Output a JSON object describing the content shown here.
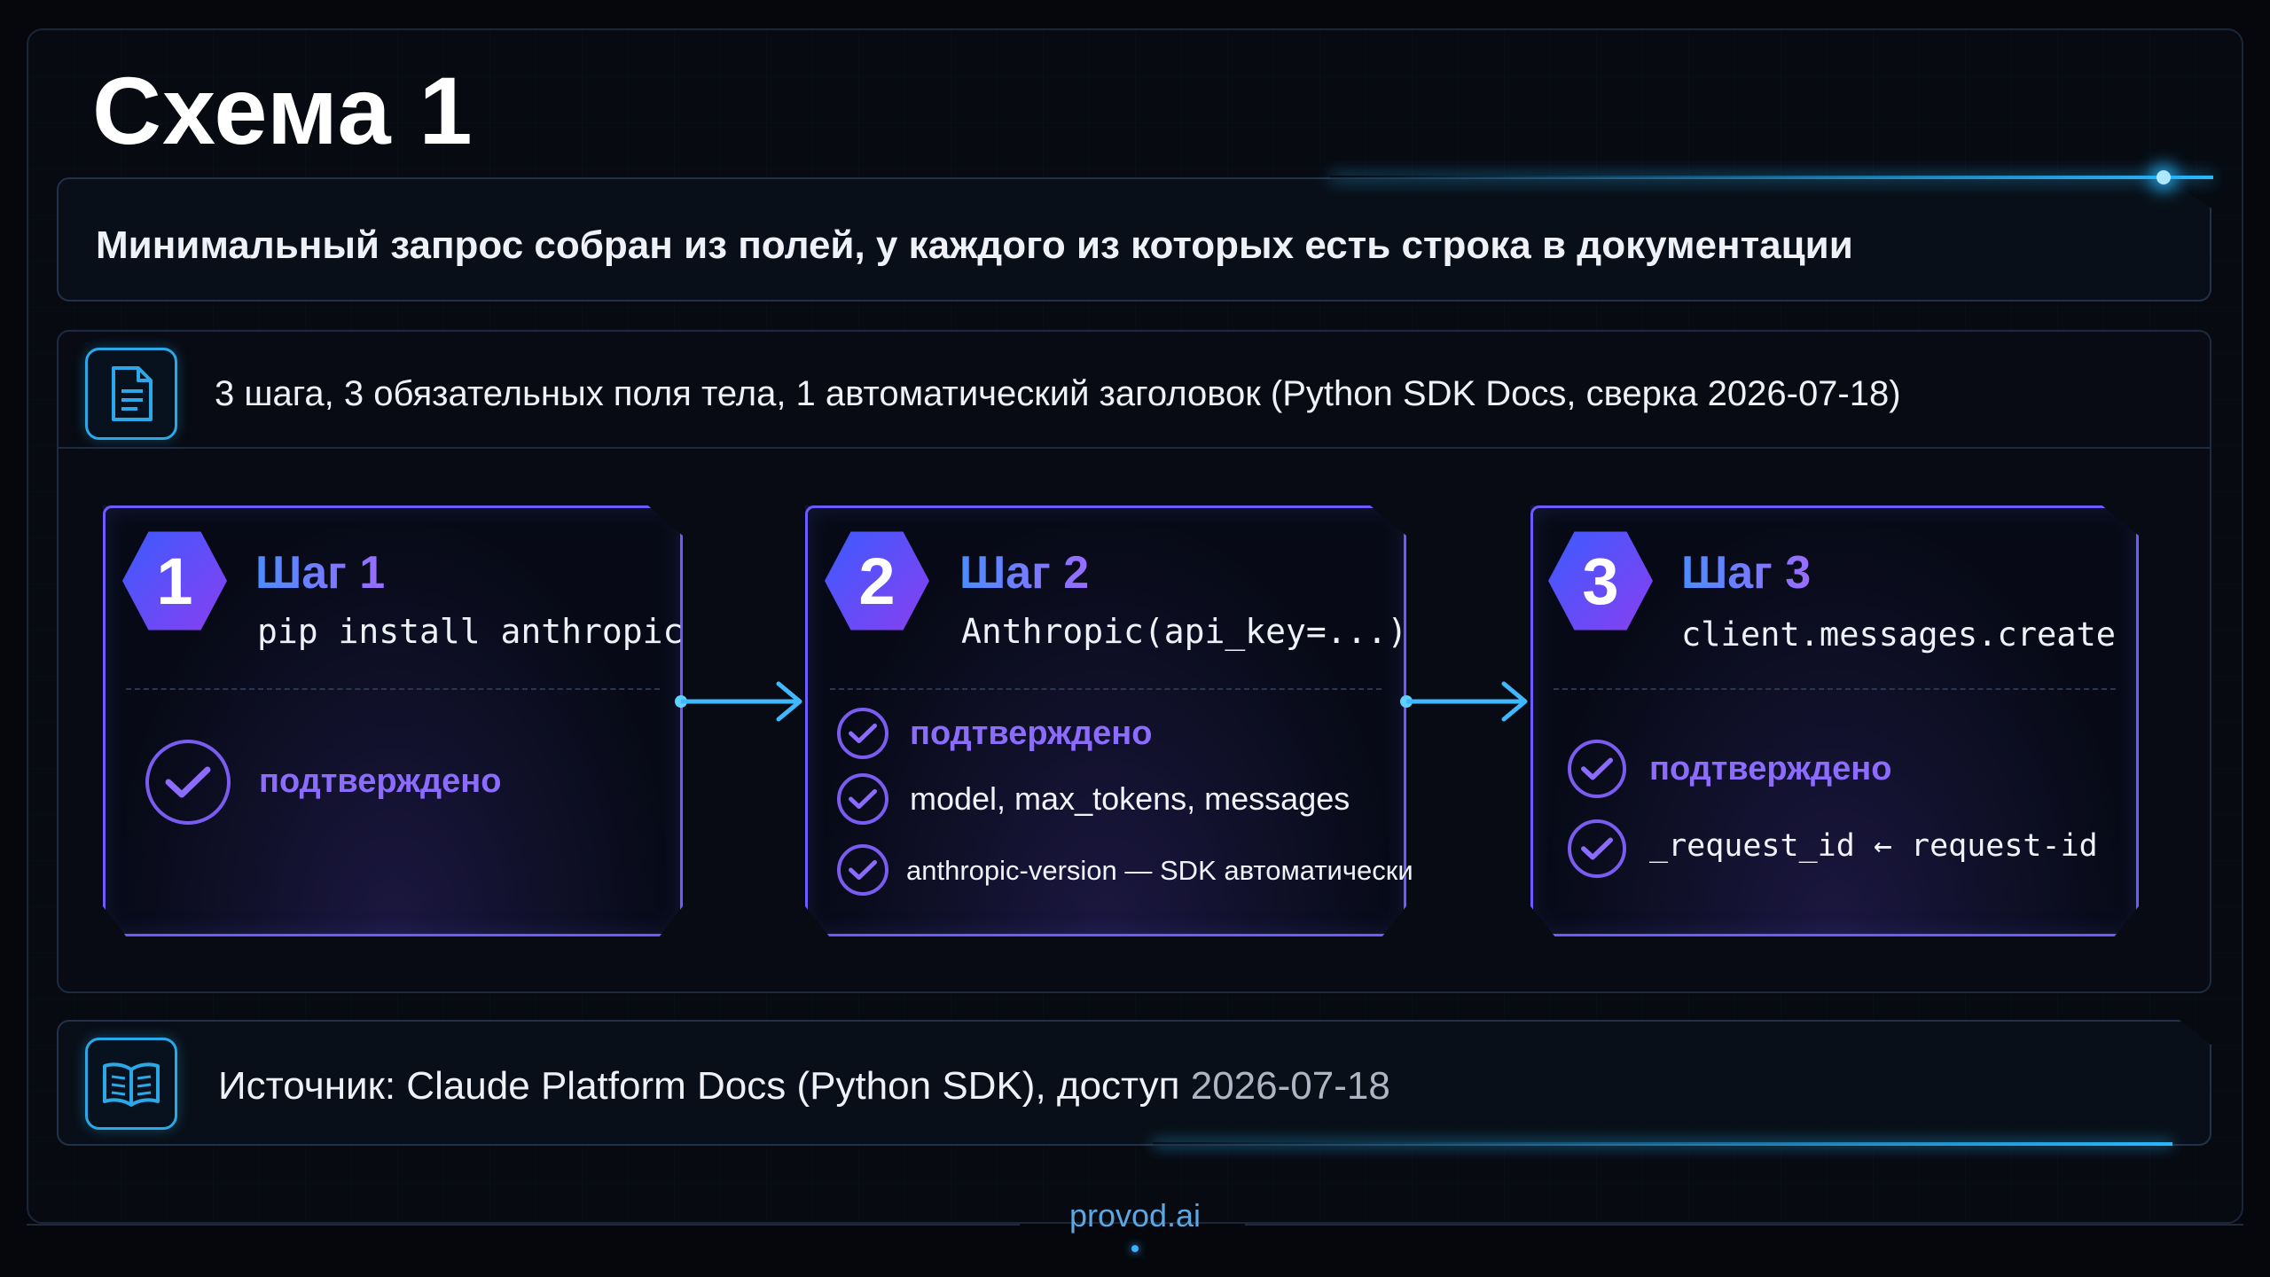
{
  "title": "Схема 1",
  "lead": "Минимальный запрос собран из полей, у каждого из которых есть строка в документации",
  "summary": "3 шага, 3 обязательных поля тела, 1 автоматический заголовок (Python SDK Docs, сверка 2026-07-18)",
  "steps": [
    {
      "number": "1",
      "label": "Шаг 1",
      "command": "pip install anthropic",
      "checks": [
        "подтверждено"
      ]
    },
    {
      "number": "2",
      "label": "Шаг 2",
      "command": "Anthropic(api_key=...)",
      "checks": [
        "подтверждено",
        "model, max_tokens, messages",
        "anthropic-version — SDK автоматически"
      ]
    },
    {
      "number": "3",
      "label": "Шаг 3",
      "command": "client.messages.create",
      "checks": [
        "подтверждено",
        "_request_id ← request-id"
      ]
    }
  ],
  "source": {
    "prefix": "Источник: Claude Platform Docs (Python SDK), доступ ",
    "date": "2026-07-18"
  },
  "footer": "provod.ai",
  "colors": {
    "accent_blue": "#28b8ff",
    "accent_purple": "#7b5cf0",
    "background": "#05070c"
  },
  "icons": {
    "summary": "document-icon",
    "source": "book-icon",
    "check": "check-circle-icon"
  }
}
